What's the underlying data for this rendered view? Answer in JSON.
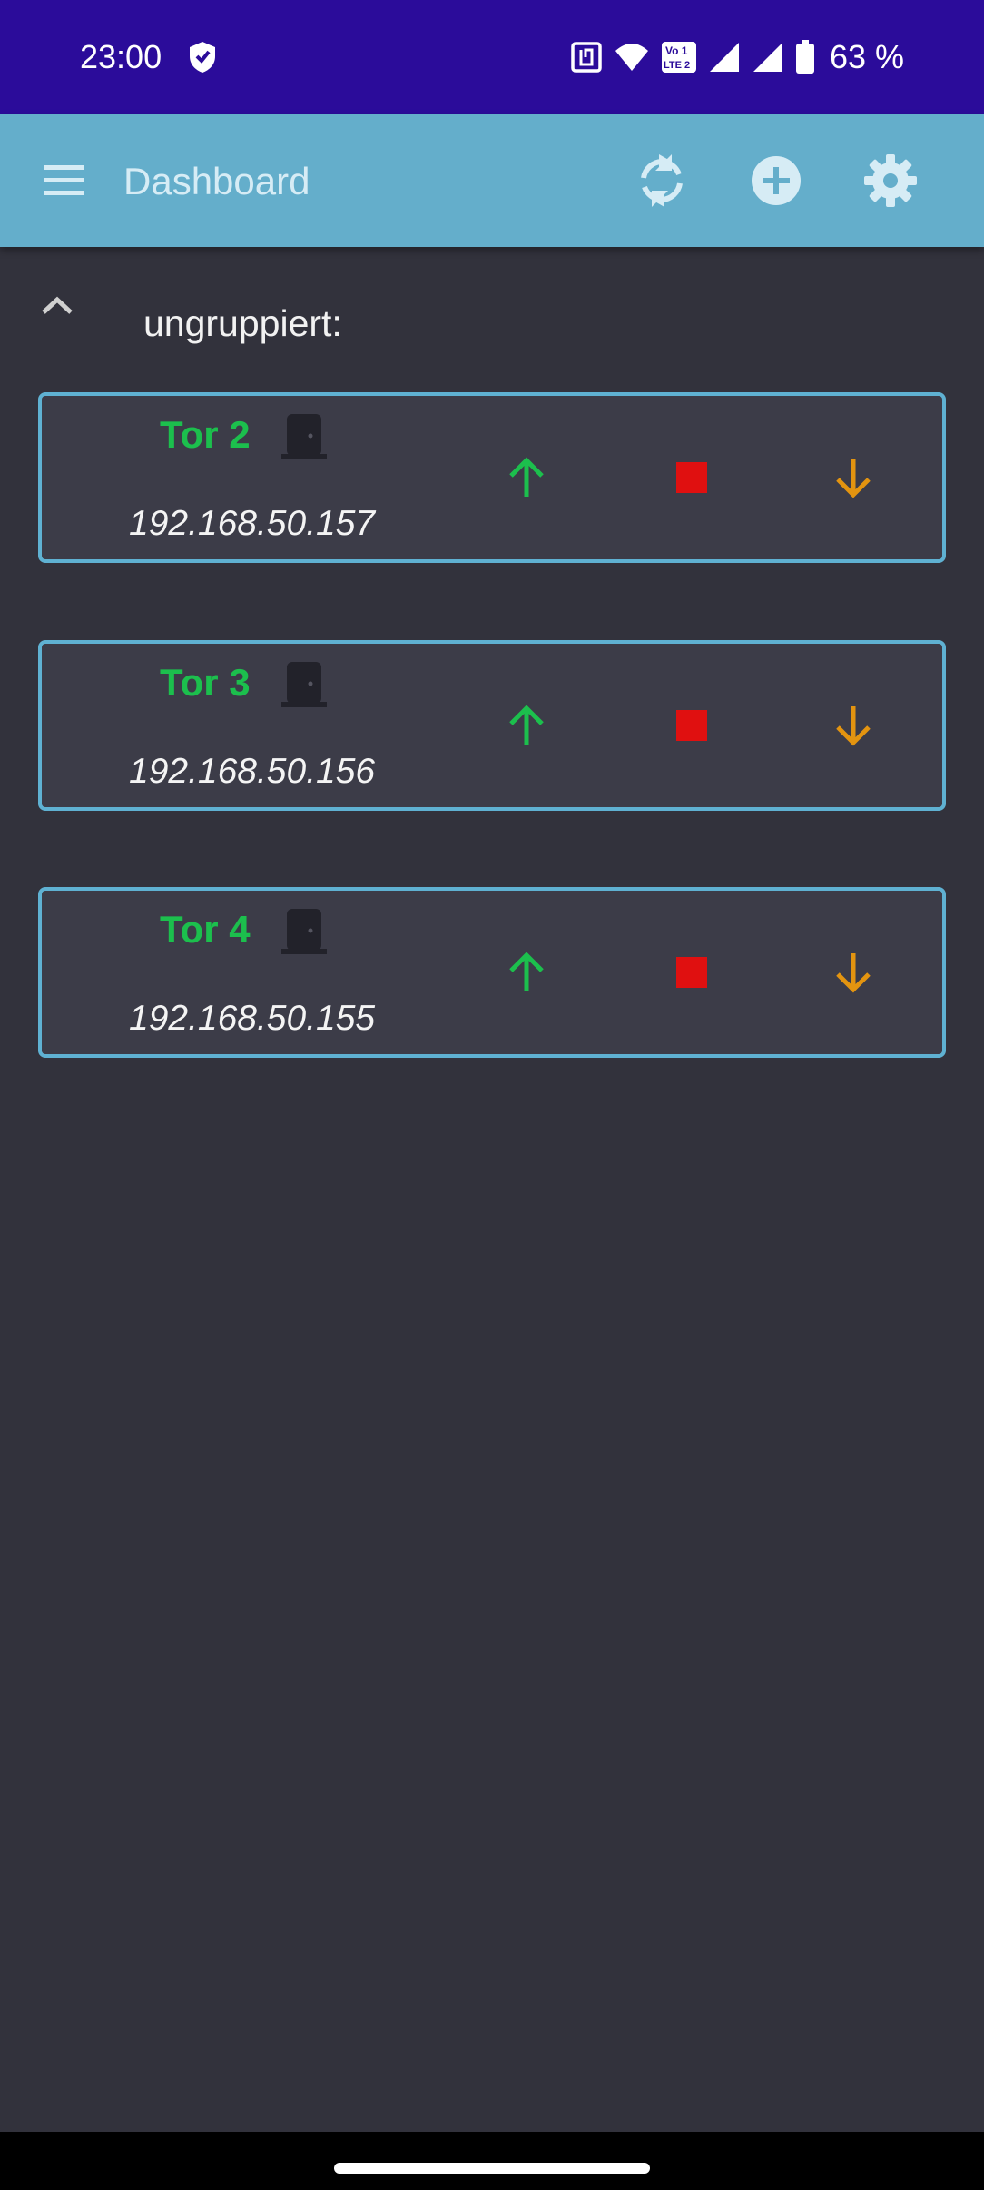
{
  "status_bar": {
    "time": "23:00",
    "battery_percent": "63 %",
    "icons": [
      "shield-icon",
      "nfc-icon",
      "wifi-icon",
      "volte-icon",
      "signal-icon",
      "signal-icon",
      "battery-icon"
    ]
  },
  "app_bar": {
    "title": "Dashboard",
    "actions": [
      "refresh-icon",
      "add-icon",
      "settings-icon"
    ]
  },
  "group": {
    "label": "ungruppiert:",
    "expanded": true
  },
  "devices": [
    {
      "name": "Tor 2",
      "ip": "192.168.50.157"
    },
    {
      "name": "Tor 3",
      "ip": "192.168.50.156"
    },
    {
      "name": "Tor 4",
      "ip": "192.168.50.155"
    }
  ],
  "colors": {
    "status_bar": "#2b0c9a",
    "app_bar": "#64aecb",
    "background": "#32323c",
    "card_border": "#5fb1d2",
    "device_name": "#1cbf4d",
    "up_arrow": "#1cbf4d",
    "stop": "#e01010",
    "down_arrow": "#e39410"
  }
}
